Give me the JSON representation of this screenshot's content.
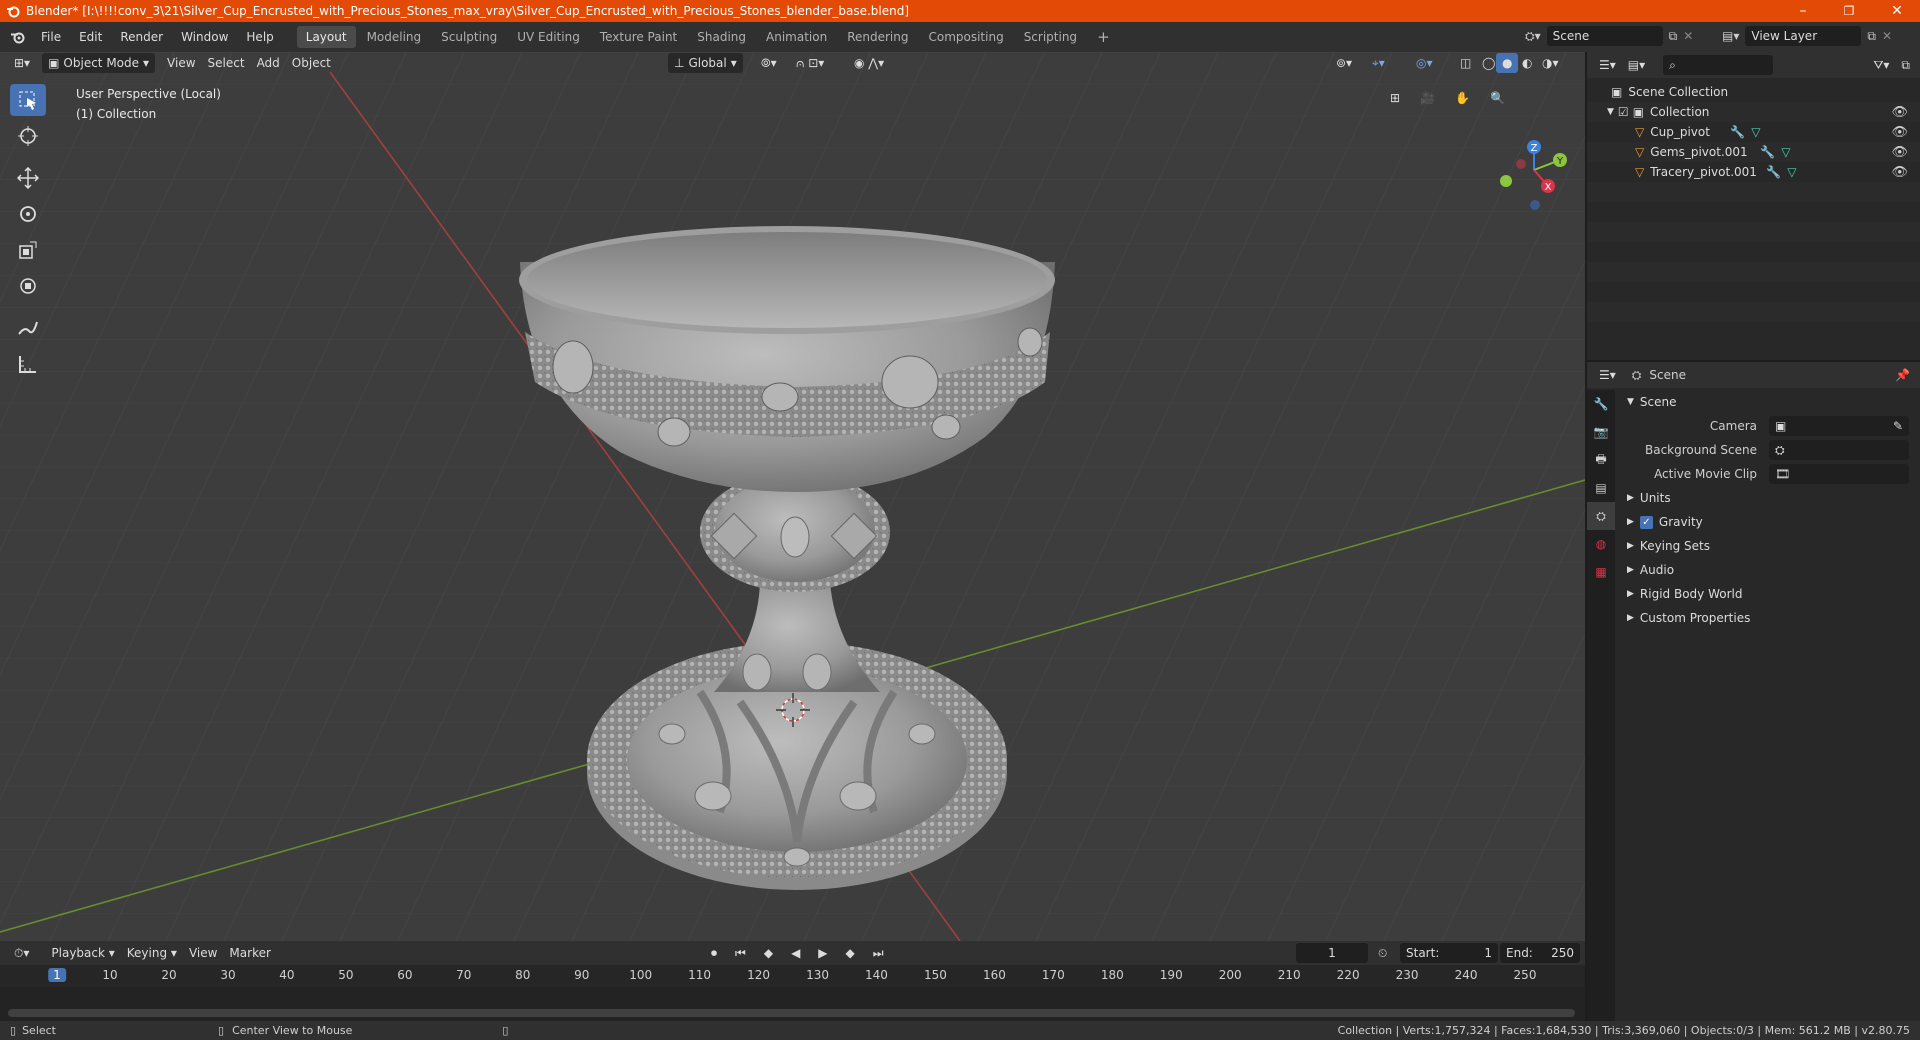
{
  "titlebar": {
    "title": "Blender* [I:\\!!!!conv_3\\21\\Silver_Cup_Encrusted_with_Precious_Stones_max_vray\\Silver_Cup_Encrusted_with_Precious_Stones_blender_base.blend]",
    "minimize": "–",
    "maximize": "❐",
    "close": "✕"
  },
  "menu": {
    "file": "File",
    "edit": "Edit",
    "render": "Render",
    "window": "Window",
    "help": "Help"
  },
  "workspaces": [
    "Layout",
    "Modeling",
    "Sculpting",
    "UV Editing",
    "Texture Paint",
    "Shading",
    "Animation",
    "Rendering",
    "Compositing",
    "Scripting"
  ],
  "workspace_add": "+",
  "scene_field": "Scene",
  "view_layer_field": "View Layer",
  "viewport": {
    "mode": "Object Mode",
    "view": "View",
    "select": "Select",
    "add": "Add",
    "object": "Object",
    "transform_orientation": "Global",
    "perspective": "User Perspective (Local)",
    "collection": "(1) Collection",
    "gizmo": {
      "z": "Z",
      "y": "Y",
      "x": "X"
    }
  },
  "outliner": {
    "scene_collection": "Scene Collection",
    "collection": "Collection",
    "objects": [
      "Cup_pivot",
      "Gems_pivot.001",
      "Tracery_pivot.001"
    ]
  },
  "properties": {
    "context": "Scene",
    "panel": "Scene",
    "camera_label": "Camera",
    "background_scene_label": "Background Scene",
    "active_movie_clip_label": "Active Movie Clip",
    "subpanels": [
      "Units",
      "Gravity",
      "Keying Sets",
      "Audio",
      "Rigid Body World",
      "Custom Properties"
    ],
    "gravity_checked": true
  },
  "timeline": {
    "playback": "Playback",
    "keying": "Keying",
    "view": "View",
    "marker": "Marker",
    "current_frame": "1",
    "start_label": "Start:",
    "start": "1",
    "end_label": "End:",
    "end": "250",
    "ticks": [
      "1",
      "10",
      "20",
      "30",
      "40",
      "50",
      "60",
      "70",
      "80",
      "90",
      "100",
      "110",
      "120",
      "130",
      "140",
      "150",
      "160",
      "170",
      "180",
      "190",
      "200",
      "210",
      "220",
      "230",
      "240",
      "250"
    ]
  },
  "statusbar": {
    "select": "Select",
    "center_view": "Center View to Mouse",
    "stats": "Collection | Verts:1,757,324 | Faces:1,684,530 | Tris:3,369,060 | Objects:0/3 | Mem: 561.2 MB | v2.80.75"
  },
  "colors": {
    "titlebar": "#e24a05",
    "accent": "#4772b3",
    "viewport_bg": "#3d3d3d",
    "x_axis": "#d8354a",
    "y_axis": "#8cc63f",
    "z_axis": "#3b82e0"
  }
}
